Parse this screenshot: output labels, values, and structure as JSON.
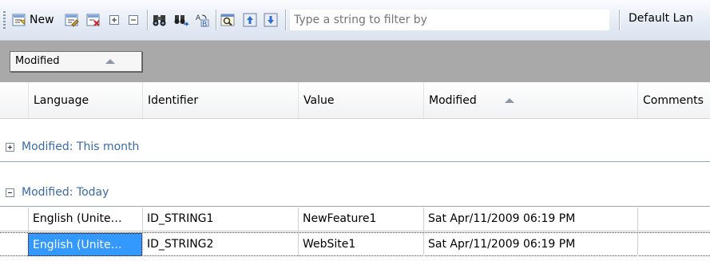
{
  "toolbar": {
    "new_label": "New",
    "filter_placeholder": "Type a string to filter by",
    "language_combo": "Default Lan"
  },
  "group_panel": {
    "chip_label": "Modified"
  },
  "columns": {
    "language": "Language",
    "identifier": "Identifier",
    "value": "Value",
    "modified": "Modified",
    "comments": "Comments"
  },
  "groups": [
    {
      "label": "Modified: This month",
      "expanded": false
    },
    {
      "label": "Modified: Today",
      "expanded": true
    }
  ],
  "rows": [
    {
      "language": "English (Unite…",
      "identifier": "ID_STRING1",
      "value": "NewFeature1",
      "modified": "Sat Apr/11/2009 06:19 PM",
      "comments": ""
    },
    {
      "language": "English (Unite…",
      "identifier": "ID_STRING2",
      "value": "WebSite1",
      "modified": "Sat Apr/11/2009 06:19 PM",
      "comments": ""
    }
  ],
  "colors": {
    "selection": "#3399ff",
    "group_text": "#3b6aa8",
    "group_panel": "#a9a9a9"
  }
}
